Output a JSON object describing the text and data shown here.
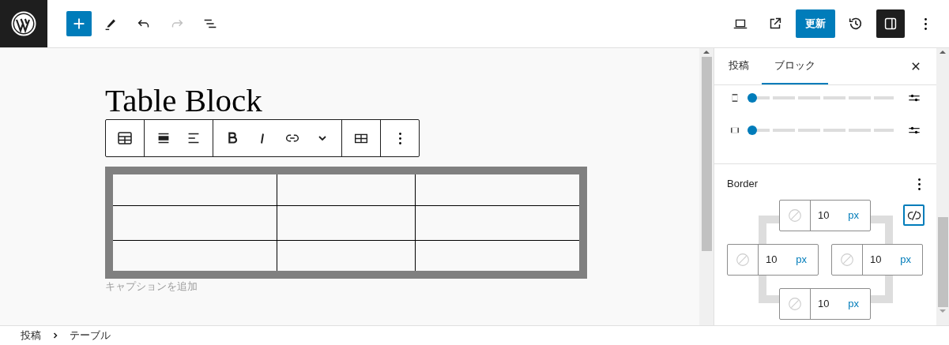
{
  "header": {
    "update_button": "更新",
    "redo_disabled": true,
    "sidebar_open": true
  },
  "editor": {
    "title": "Table Block",
    "table": {
      "rows": [
        [
          "",
          "",
          ""
        ],
        [
          "",
          "",
          ""
        ],
        [
          "",
          "",
          ""
        ]
      ]
    },
    "caption_placeholder": "キャプションを追加"
  },
  "sidebar": {
    "tabs": [
      {
        "label": "投稿",
        "selected": false
      },
      {
        "label": "ブロック",
        "selected": true
      }
    ],
    "sliders": [
      {
        "kind": "vertical",
        "level": 0
      },
      {
        "kind": "horizontal",
        "level": 0
      }
    ],
    "border": {
      "title": "Border",
      "linked": false,
      "sides": [
        {
          "value": "10",
          "unit": "px"
        },
        {
          "value": "10",
          "unit": "px"
        },
        {
          "value": "10",
          "unit": "px"
        },
        {
          "value": "10",
          "unit": "px"
        }
      ]
    }
  },
  "breadcrumb": [
    "投稿",
    "テーブル"
  ]
}
